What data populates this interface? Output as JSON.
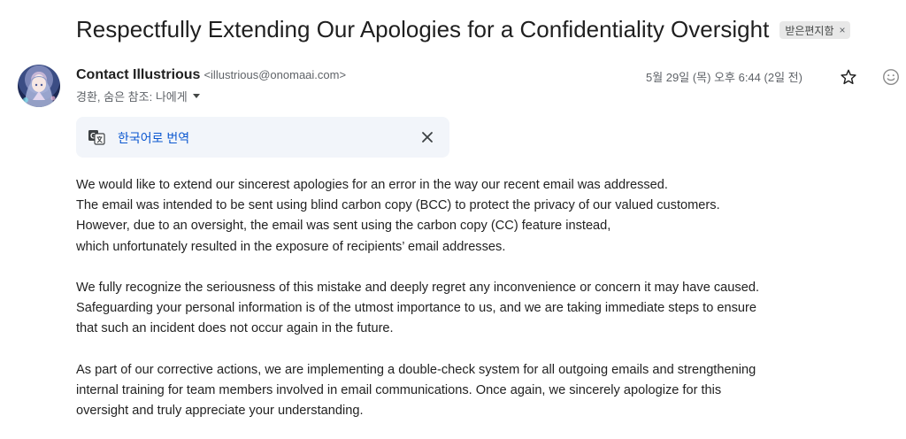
{
  "email": {
    "subject": "Respectfully Extending Our Apologies for a Confidentiality Oversight",
    "label_chip": "받은편지함",
    "label_chip_close": "×",
    "sender": {
      "name": "Contact Illustrious",
      "email": "<illustrious@onomaai.com>",
      "avatar_icon": "avatar-illustration"
    },
    "recipients_text": "경환, 숨은 참조: 나에게",
    "date": "5월 29일 (목) 오후 6:44 (2일 전)",
    "star_icon": "star-outline-icon",
    "emoji_icon": "add-reaction-icon"
  },
  "translate_bar": {
    "link_text": "한국어로 번역",
    "icon": "translate-icon",
    "close_icon": "close-icon"
  },
  "body": {
    "paragraphs": [
      [
        "We would like to extend our sincerest apologies for an error in the way our recent email was addressed.",
        "The email was intended to be sent using blind carbon copy (BCC) to protect the privacy of our valued customers.",
        "However, due to an oversight, the email was sent using the carbon copy (CC) feature instead,",
        "which unfortunately resulted in the exposure of recipients’ email addresses."
      ],
      [
        "We fully recognize the seriousness of this mistake and deeply regret any inconvenience or concern it may have caused.",
        "Safeguarding your personal information is of the utmost importance to us, and we are taking immediate steps to ensure",
        "that such an incident does not occur again in the future."
      ],
      [
        "As part of our corrective actions, we are implementing a double-check system for all outgoing emails and strengthening",
        "internal training for team members involved in email communications. Once again, we sincerely apologize for this",
        "oversight and truly appreciate your understanding."
      ]
    ]
  },
  "colors": {
    "link": "#0b57d0",
    "translate_bg": "#f2f5fa",
    "chip_bg": "#e8e8e8",
    "muted_text": "#5f6368"
  }
}
